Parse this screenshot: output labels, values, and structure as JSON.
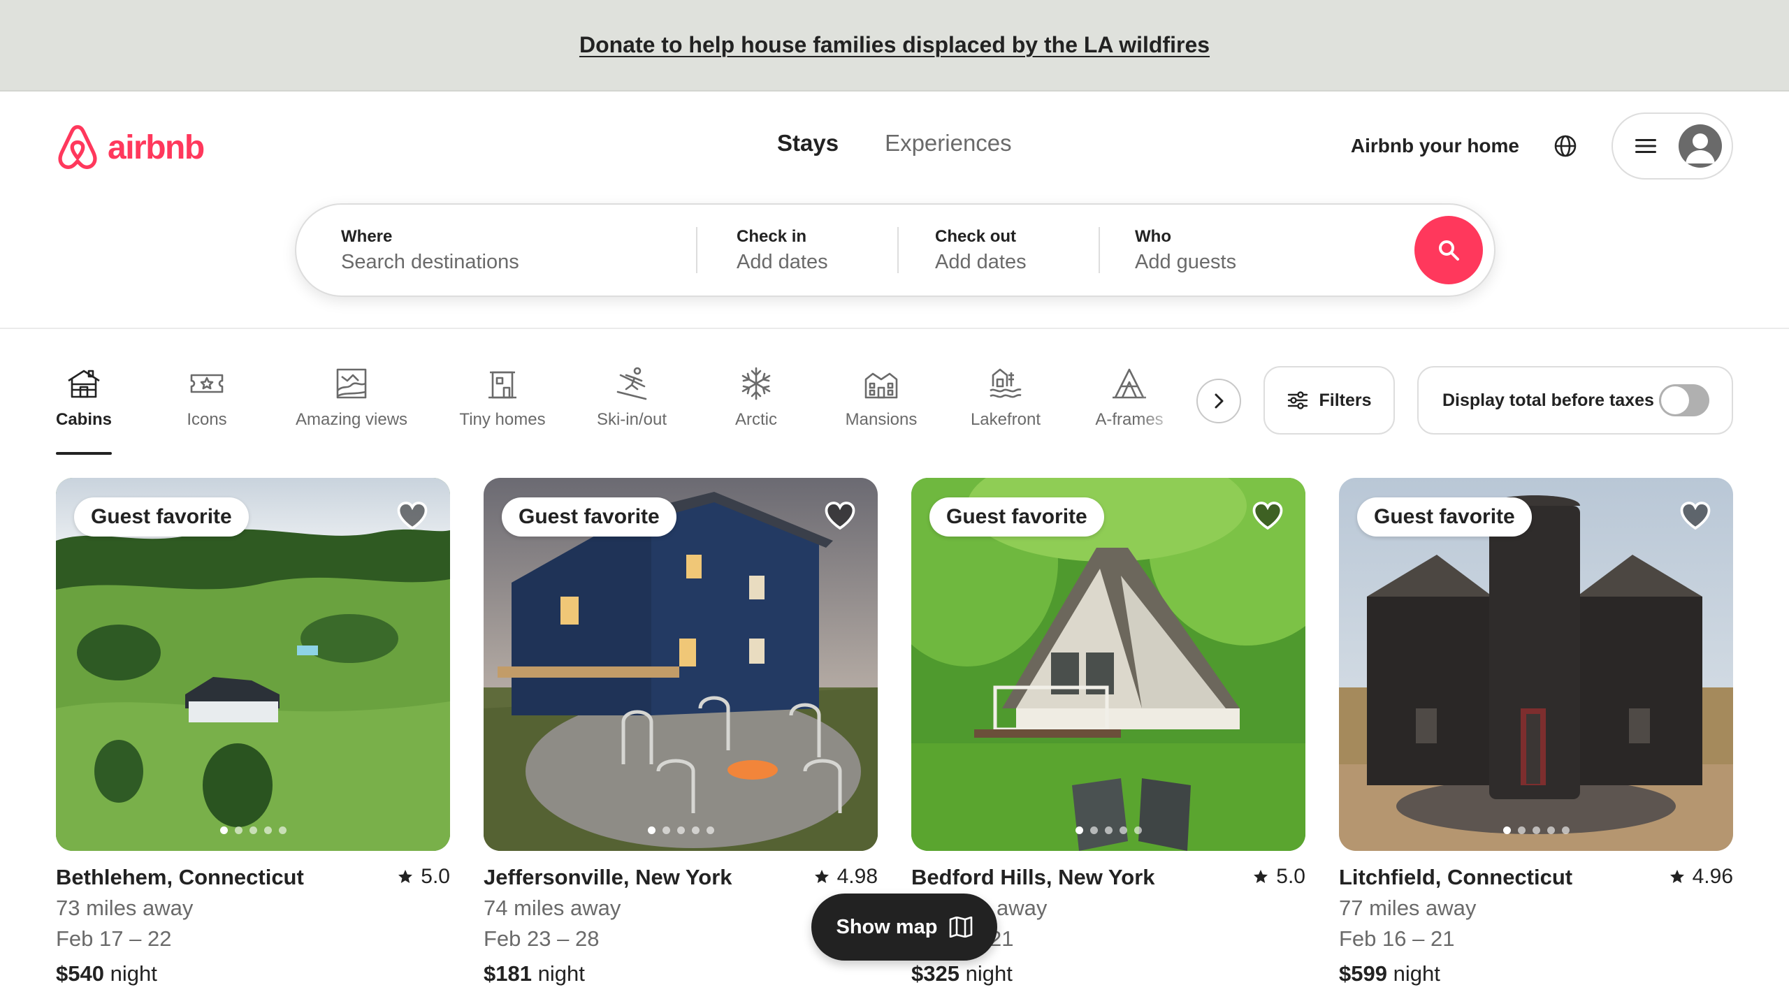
{
  "banner": {
    "text": "Donate to help house families displaced by the LA wildfires"
  },
  "header": {
    "logo_text": "airbnb",
    "brand_color": "#ff385c",
    "tabs": [
      {
        "label": "Stays",
        "active": true
      },
      {
        "label": "Experiences",
        "active": false
      }
    ],
    "host_link": "Airbnb your home"
  },
  "search": {
    "where": {
      "label": "Where",
      "placeholder": "Search destinations"
    },
    "check_in": {
      "label": "Check in",
      "value": "Add dates"
    },
    "check_out": {
      "label": "Check out",
      "value": "Add dates"
    },
    "who": {
      "label": "Who",
      "value": "Add guests"
    }
  },
  "categories": [
    {
      "label": "Cabins",
      "icon": "cabin-icon",
      "active": true
    },
    {
      "label": "Icons",
      "icon": "icons-ticket-icon",
      "active": false
    },
    {
      "label": "Amazing views",
      "icon": "amazing-views-icon",
      "active": false
    },
    {
      "label": "Tiny homes",
      "icon": "tiny-home-icon",
      "active": false
    },
    {
      "label": "Ski-in/out",
      "icon": "skier-icon",
      "active": false
    },
    {
      "label": "Arctic",
      "icon": "snowflake-icon",
      "active": false
    },
    {
      "label": "Mansions",
      "icon": "mansion-icon",
      "active": false
    },
    {
      "label": "Lakefront",
      "icon": "lakefront-icon",
      "active": false
    },
    {
      "label": "A-frames",
      "icon": "a-frame-icon",
      "active": false
    }
  ],
  "filters": {
    "label": "Filters"
  },
  "tax_toggle": {
    "label": "Display total before taxes",
    "on": false
  },
  "listings": [
    {
      "badge": "Guest favorite",
      "location": "Bethlehem, Connecticut",
      "rating": "5.0",
      "distance": "73 miles away",
      "dates": "Feb 17 – 22",
      "price": "$540",
      "price_unit": "night"
    },
    {
      "badge": "Guest favorite",
      "location": "Jeffersonville, New York",
      "rating": "4.98",
      "distance": "74 miles away",
      "dates": "Feb 23 – 28",
      "price": "$181",
      "price_unit": "night"
    },
    {
      "badge": "Guest favorite",
      "location": "Bedford Hills, New York",
      "rating": "5.0",
      "distance": "away",
      "dates": "21",
      "price": "$325",
      "price_unit": "night"
    },
    {
      "badge": "Guest favorite",
      "location": "Litchfield, Connecticut",
      "rating": "4.96",
      "distance": "77 miles away",
      "dates": "Feb 16 – 21",
      "price": "$599",
      "price_unit": "night"
    }
  ],
  "show_map": {
    "label": "Show map"
  }
}
